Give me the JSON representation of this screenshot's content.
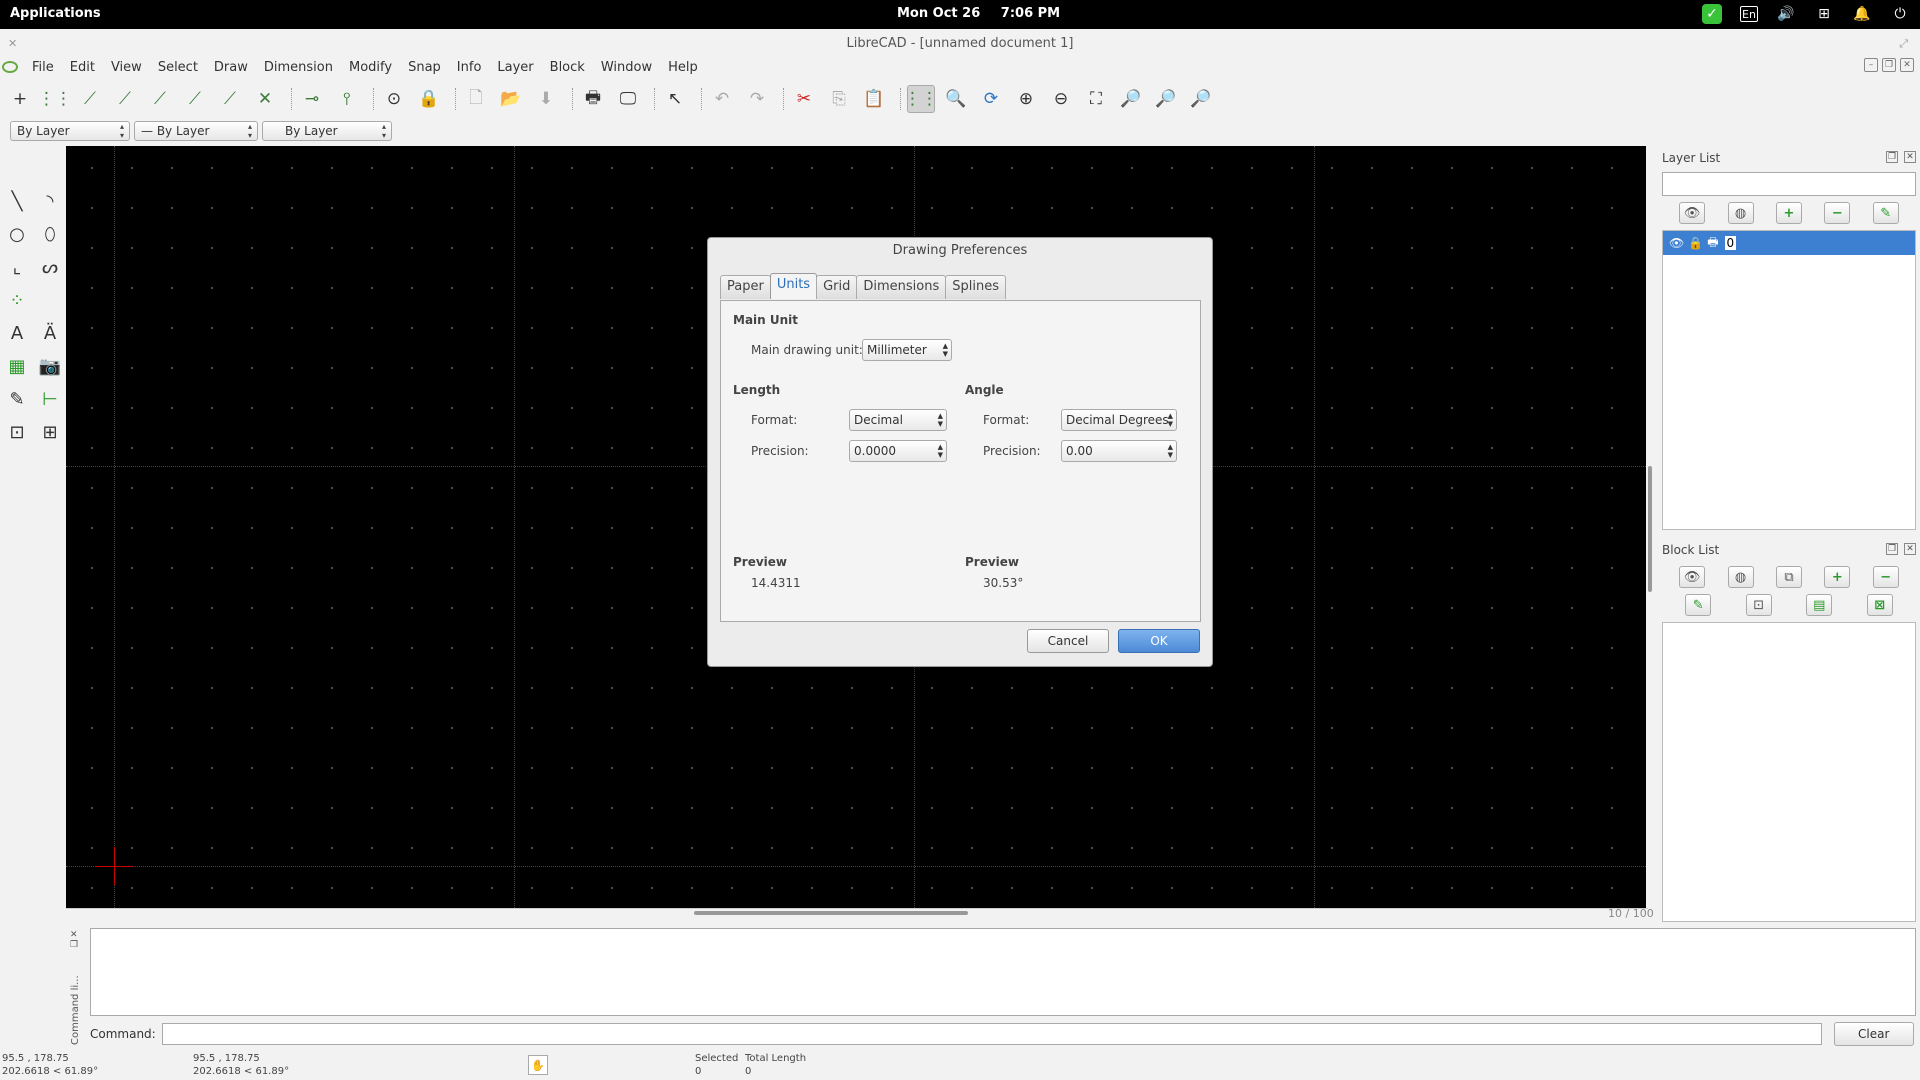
{
  "system": {
    "applications": "Applications",
    "date": "Mon Oct 26",
    "time": "7:06 PM",
    "lang": "En"
  },
  "window": {
    "title": "LibreCAD - [unnamed document 1]"
  },
  "menu": {
    "items": [
      "File",
      "Edit",
      "View",
      "Select",
      "Draw",
      "Dimension",
      "Modify",
      "Snap",
      "Info",
      "Layer",
      "Block",
      "Window",
      "Help"
    ]
  },
  "pen": {
    "color": "By Layer",
    "linetype": "— By Layer",
    "width": "By Layer"
  },
  "canvas": {
    "zoom_label": "10 / 100"
  },
  "layer_list": {
    "title": "Layer List",
    "layers": [
      {
        "name": "0"
      }
    ]
  },
  "block_list": {
    "title": "Block List"
  },
  "command": {
    "side_label": "Command li...",
    "label": "Command:",
    "clear": "Clear"
  },
  "status": {
    "abs_coord": "95.5 , 178.75",
    "abs_polar": "202.6618 < 61.89°",
    "rel_coord": "95.5 , 178.75",
    "rel_polar": "202.6618 < 61.89°",
    "selected_label": "Selected",
    "selected_value": "0",
    "total_length_label": "Total Length",
    "total_length_value": "0"
  },
  "dialog": {
    "title": "Drawing Preferences",
    "tabs": [
      "Paper",
      "Units",
      "Grid",
      "Dimensions",
      "Splines"
    ],
    "active_tab": "Units",
    "main_unit_heading": "Main Unit",
    "main_unit_label": "Main drawing unit:",
    "main_unit_value": "Millimeter",
    "length_heading": "Length",
    "length_format_label": "Format:",
    "length_format_value": "Decimal",
    "length_precision_label": "Precision:",
    "length_precision_value": "0.0000",
    "angle_heading": "Angle",
    "angle_format_label": "Format:",
    "angle_format_value": "Decimal Degrees",
    "angle_precision_label": "Precision:",
    "angle_precision_value": "0.00",
    "length_preview_heading": "Preview",
    "length_preview_value": "14.4311",
    "angle_preview_heading": "Preview",
    "angle_preview_value": "30.53°",
    "cancel": "Cancel",
    "ok": "OK"
  }
}
